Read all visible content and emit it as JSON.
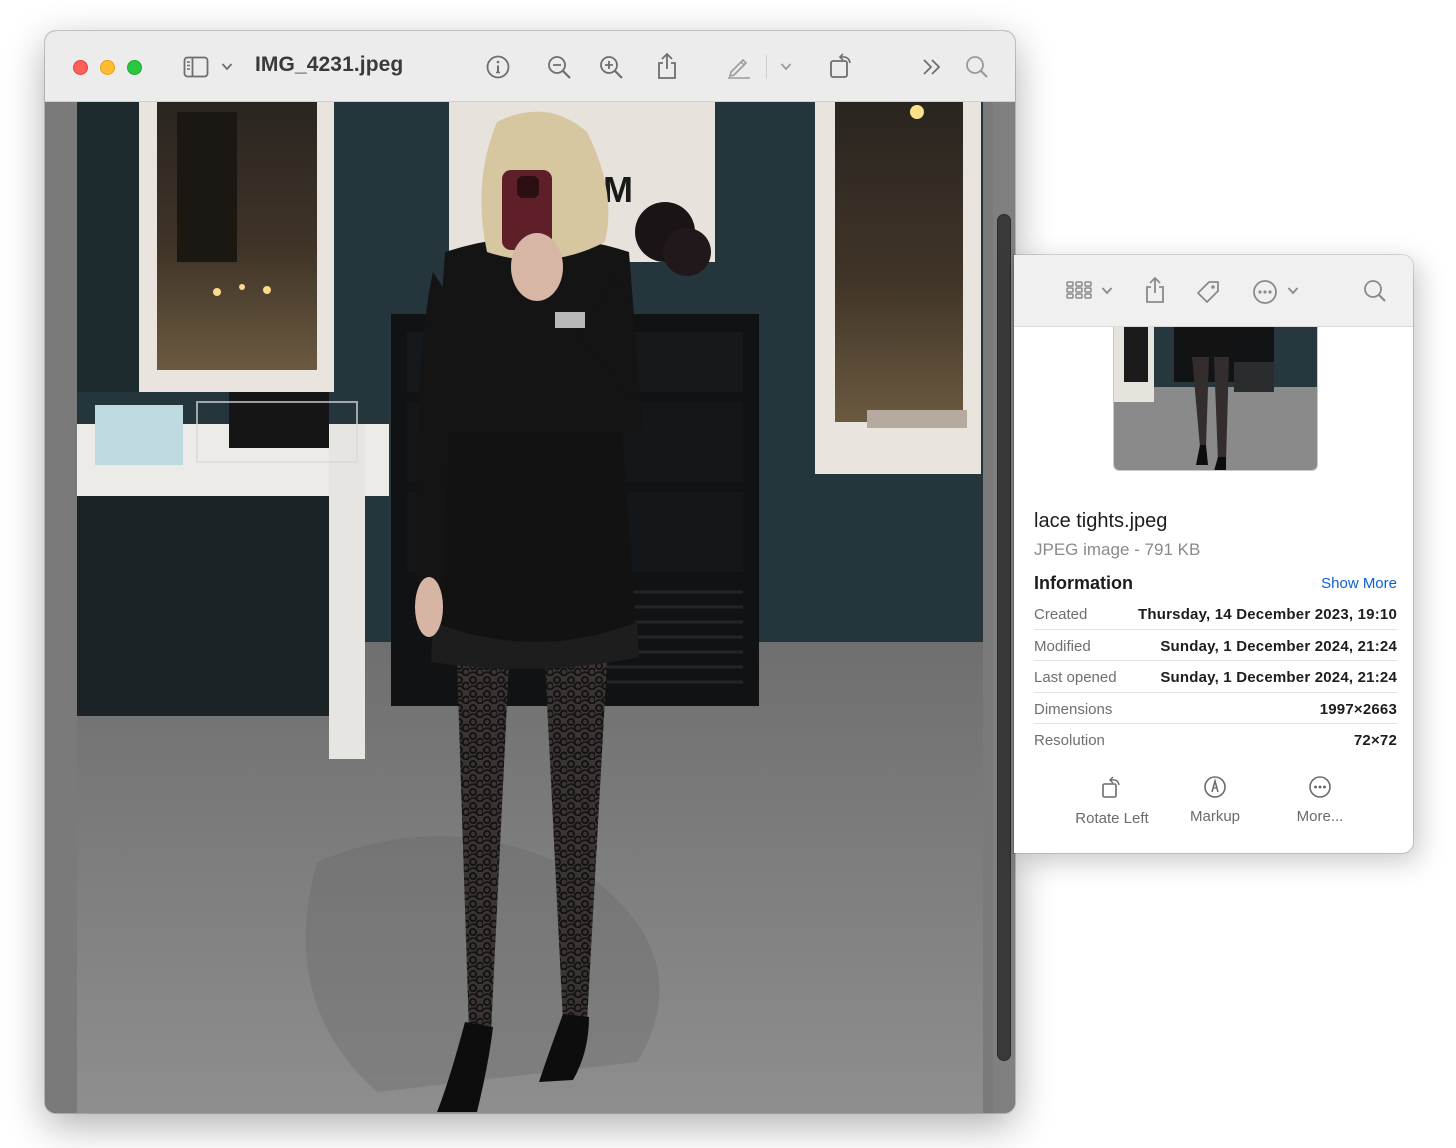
{
  "preview": {
    "title": "IMG_4231.jpeg",
    "toolbar_icons": [
      "sidebar-icon",
      "chevron-down-icon",
      "info-icon",
      "zoom-out-icon",
      "zoom-in-icon",
      "share-icon",
      "markup-pen-icon",
      "chevron-down-icon",
      "rotate-icon",
      "more-toolbar-icon",
      "search-icon"
    ]
  },
  "info": {
    "toolbar_icons": [
      "view-grid-icon",
      "chevron-down-icon",
      "share-icon",
      "tag-icon",
      "ellipsis-icon",
      "chevron-down-icon",
      "search-icon"
    ],
    "file_name": "lace tights.jpeg",
    "file_kind": "JPEG image - 791 KB",
    "section_title": "Information",
    "show_more": "Show More",
    "rows": [
      {
        "key": "Created",
        "value": "Thursday, 14 December 2023, 19:10"
      },
      {
        "key": "Modified",
        "value": "Sunday, 1 December 2024, 21:24"
      },
      {
        "key": "Last opened",
        "value": "Sunday, 1 December 2024, 21:24"
      },
      {
        "key": "Dimensions",
        "value": "1997×2663"
      },
      {
        "key": "Resolution",
        "value": "72×72"
      }
    ],
    "actions": [
      {
        "label": "Rotate Left",
        "icon": "rotate-left-icon"
      },
      {
        "label": "Markup",
        "icon": "markup-icon"
      },
      {
        "label": "More...",
        "icon": "more-icon"
      }
    ]
  },
  "colors": {
    "close": "#ff5f57",
    "minimize": "#febc2e",
    "zoom": "#28c840",
    "link": "#0a60d6"
  }
}
